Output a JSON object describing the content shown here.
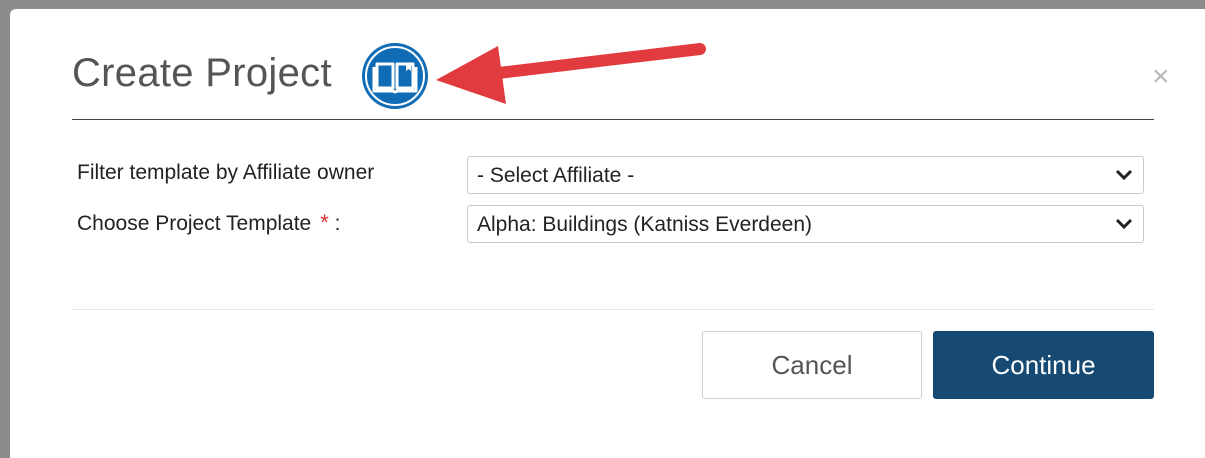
{
  "dialog": {
    "title": "Create Project",
    "help_icon": "book-icon",
    "close_label": "×"
  },
  "form": {
    "affiliate": {
      "label": "Filter template by Affiliate owner",
      "value": "- Select Affiliate -"
    },
    "template": {
      "label": "Choose Project Template",
      "required_mark": "*",
      "colon": ":",
      "value": "Alpha: Buildings (Katniss Everdeen)"
    }
  },
  "buttons": {
    "cancel": "Cancel",
    "continue": "Continue"
  },
  "colors": {
    "primary": "#174a73",
    "help_icon": "#0f6cb5",
    "annotation_arrow": "#e23b3f",
    "required": "#d9342b"
  }
}
